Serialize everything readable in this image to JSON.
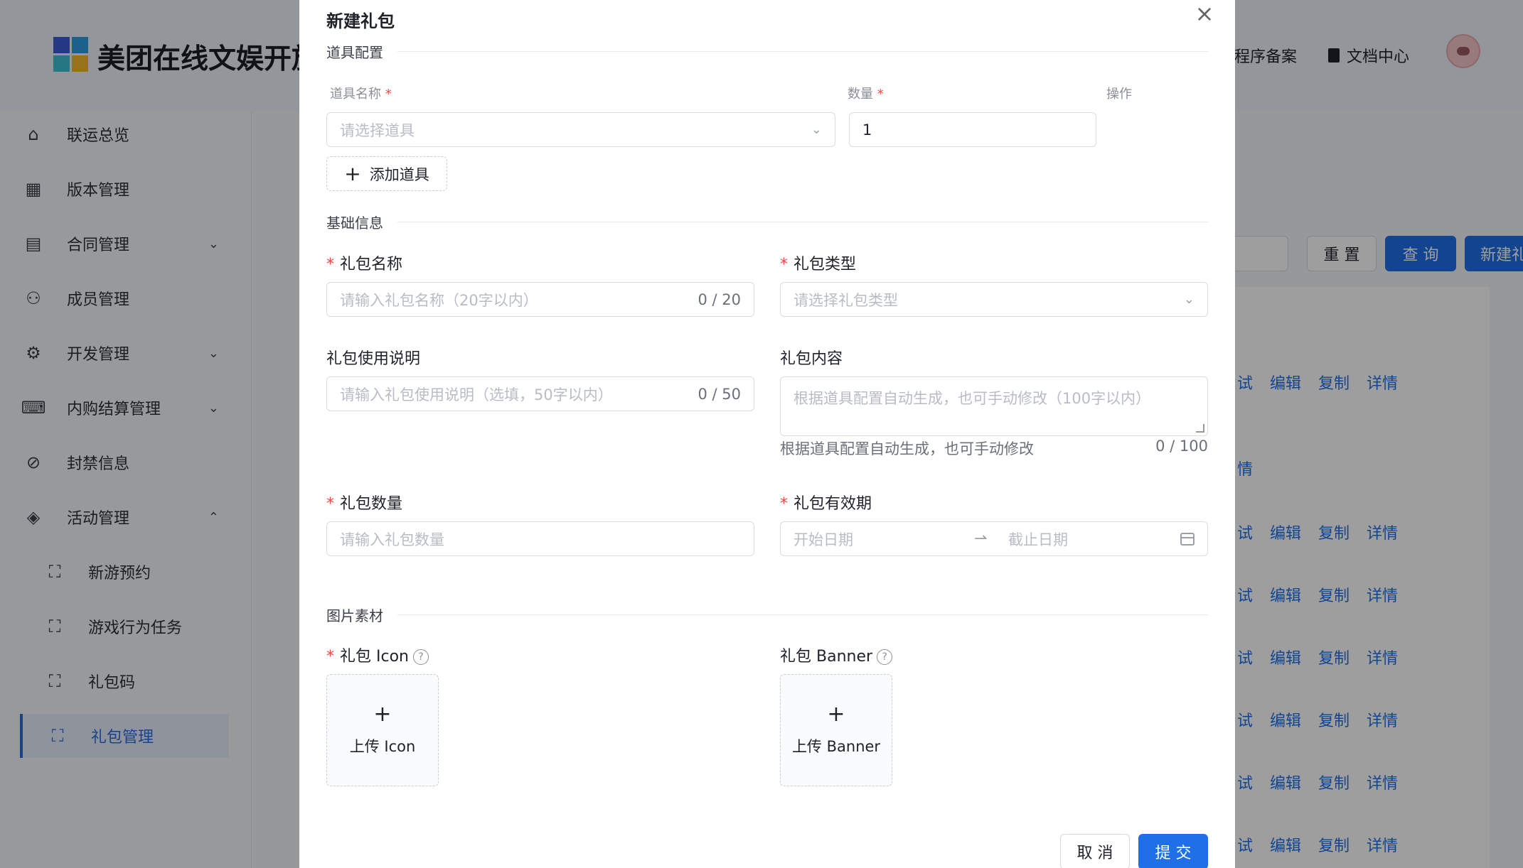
{
  "app": {
    "brand": "美团在线文娱开放",
    "top_links": [
      "程序备案",
      "文档中心"
    ]
  },
  "sidebar": {
    "items": [
      {
        "label": "联运总览",
        "icon": "home-icon"
      },
      {
        "label": "版本管理",
        "icon": "grid-icon"
      },
      {
        "label": "合同管理",
        "icon": "document-icon"
      },
      {
        "label": "成员管理",
        "icon": "users-icon"
      },
      {
        "label": "开发管理",
        "icon": "gear-icon"
      },
      {
        "label": "内购结算管理",
        "icon": "keyboard-icon"
      },
      {
        "label": "封禁信息",
        "icon": "ban-icon"
      },
      {
        "label": "活动管理",
        "icon": "layers-icon"
      },
      {
        "label": "新游预约",
        "icon": "frame-icon"
      },
      {
        "label": "游戏行为任务",
        "icon": "frame-icon"
      },
      {
        "label": "礼包码",
        "icon": "frame-icon"
      },
      {
        "label": "礼包管理",
        "icon": "frame-icon"
      }
    ]
  },
  "background": {
    "reset": "重 置",
    "query": "查 询",
    "new": "新建礼",
    "row_actions": [
      "试",
      "编辑",
      "复制",
      "详情"
    ],
    "detail_only": "情"
  },
  "modal": {
    "title": "新建礼包",
    "close": "×",
    "section_items": "道具配置",
    "col_item_name": "道具名称",
    "col_quantity": "数量",
    "col_ops": "操作",
    "item_select_placeholder": "请选择道具",
    "quantity_value": "1",
    "add_item": "添加道具",
    "section_basic": "基础信息",
    "gift_name_label": "礼包名称",
    "gift_name_placeholder": "请输入礼包名称（20字以内）",
    "gift_name_count": "0 / 20",
    "gift_type_label": "礼包类型",
    "gift_type_placeholder": "请选择礼包类型",
    "usage_label": "礼包使用说明",
    "usage_placeholder": "请输入礼包使用说明（选填，50字以内）",
    "usage_count": "0 / 50",
    "content_label": "礼包内容",
    "content_placeholder": "根据道具配置自动生成，也可手动修改（100字以内）",
    "content_help": "根据道具配置自动生成，也可手动修改",
    "content_count": "0 / 100",
    "qty_label": "礼包数量",
    "qty_placeholder": "请输入礼包数量",
    "validity_label": "礼包有效期",
    "start_placeholder": "开始日期",
    "end_placeholder": "截止日期",
    "section_images": "图片素材",
    "icon_label": "礼包 Icon",
    "banner_label": "礼包 Banner",
    "upload_icon": "上传 Icon",
    "upload_banner": "上传 Banner",
    "required_mark": "*",
    "cancel": "取 消",
    "submit": "提 交"
  },
  "colors": {
    "primary": "#1f6fe8",
    "required": "#f0483e"
  }
}
